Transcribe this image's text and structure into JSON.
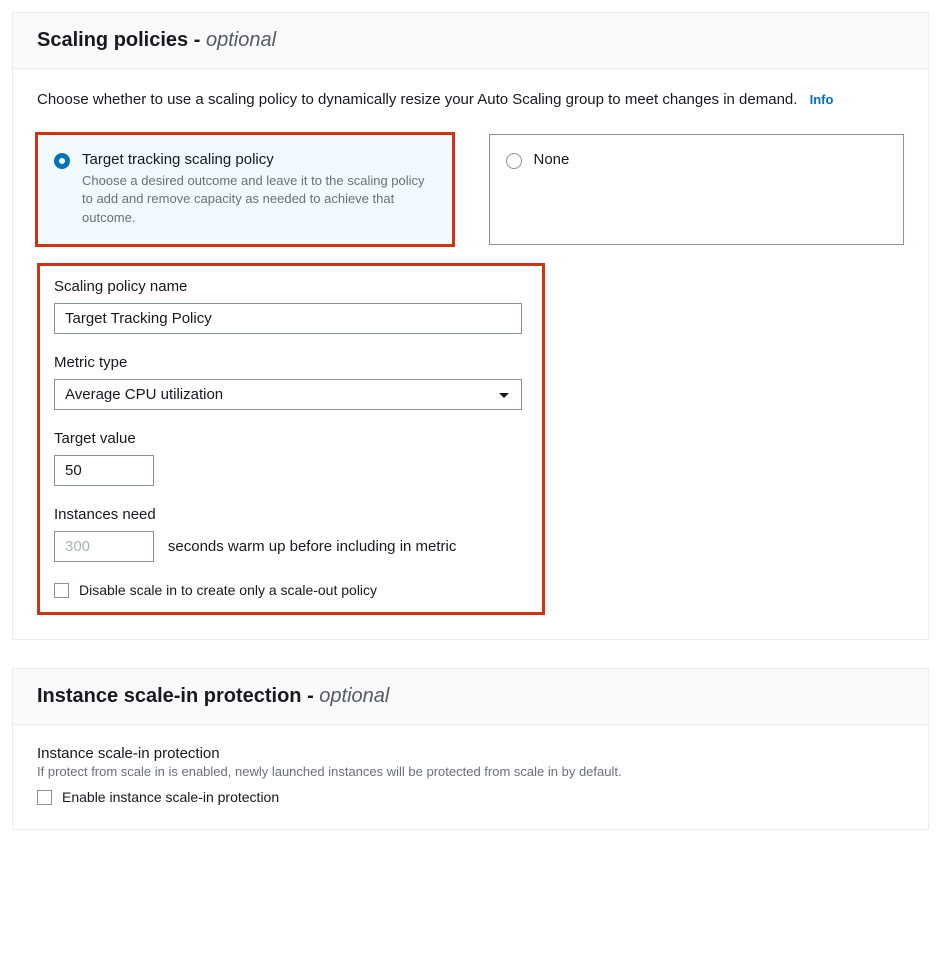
{
  "scaling_panel": {
    "title": "Scaling policies",
    "dash": " - ",
    "optional": "optional",
    "description": "Choose whether to use a scaling policy to dynamically resize your Auto Scaling group to meet changes in demand.",
    "info_label": "Info",
    "options": {
      "tracking": {
        "title": "Target tracking scaling policy",
        "description": "Choose a desired outcome and leave it to the scaling policy to add and remove capacity as needed to achieve that outcome."
      },
      "none": {
        "title": "None"
      }
    },
    "fields": {
      "policy_name": {
        "label": "Scaling policy name",
        "value": "Target Tracking Policy"
      },
      "metric_type": {
        "label": "Metric type",
        "value": "Average CPU utilization"
      },
      "target_value": {
        "label": "Target value",
        "value": "50"
      },
      "instances_need": {
        "label": "Instances need",
        "placeholder": "300",
        "suffix": "seconds warm up before including in metric"
      },
      "disable_scale_in": {
        "label": "Disable scale in to create only a scale-out policy"
      }
    }
  },
  "protection_panel": {
    "title": "Instance scale-in protection",
    "dash": " - ",
    "optional": "optional",
    "subheading": "Instance scale-in protection",
    "helper": "If protect from scale in is enabled, newly launched instances will be protected from scale in by default.",
    "checkbox_label": "Enable instance scale-in protection"
  }
}
